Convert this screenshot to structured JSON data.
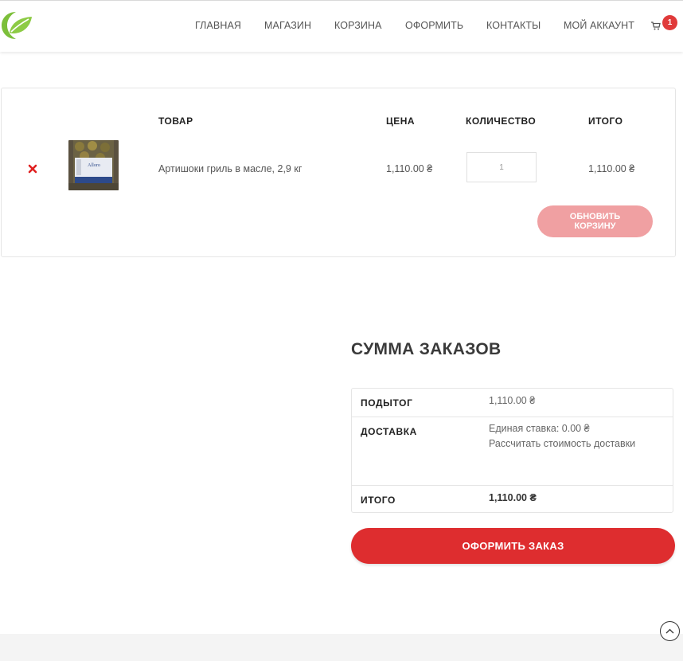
{
  "header": {
    "logo_icon": "leaf-logo-icon",
    "nav": [
      "ГЛАВНАЯ",
      "МАГАЗИН",
      "КОРЗИНА",
      "ОФОРМИТЬ",
      "КОНТАКТЫ",
      "МОЙ АККАУНТ"
    ],
    "cart_icon": "shopping-cart-icon",
    "cart_count": "1",
    "badge_color": "#e03a3a"
  },
  "cart": {
    "columns": {
      "product": "ТОВАР",
      "price": "ЦЕНА",
      "quantity": "КОЛИЧЕСТВО",
      "total": "ИТОГО"
    },
    "items": [
      {
        "remove_icon": "remove-x-icon",
        "name": "Артишоки гриль в масле, 2,9 кг",
        "price": "1,110.00 ₴",
        "quantity": "1",
        "total": "1,110.00 ₴"
      }
    ],
    "update_button": "ОБНОВИТЬ КОРЗИНУ",
    "update_color": "#f0a0a2"
  },
  "totals": {
    "title": "СУММА ЗАКАЗОВ",
    "subtotal_label": "ПОДЫТОГ",
    "subtotal_value": "1,110.00 ₴",
    "shipping_label": "ДОСТАВКА",
    "shipping_rate": "Единая ставка: 0.00 ₴",
    "shipping_calc": "Рассчитать стоимость доставки",
    "total_label": "ИТОГО",
    "total_value": "1,110.00 ₴",
    "checkout_button": "ОФОРМИТЬ ЗАКАЗ",
    "checkout_color": "#de2d2f"
  },
  "scroll_top_icon": "chevron-up-icon"
}
